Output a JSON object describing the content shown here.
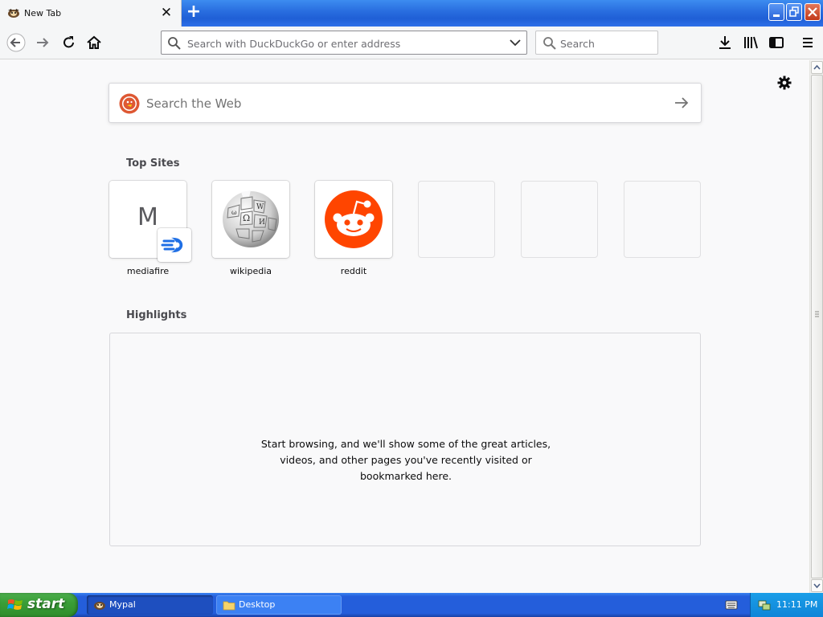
{
  "browser": {
    "tab": {
      "title": "New Tab",
      "close_icon": "close-icon",
      "favicon": "mypal-favicon"
    },
    "new_tab_icon": "plus-icon",
    "window_controls": [
      "minimize-icon",
      "restore-icon",
      "close-icon"
    ],
    "nav_icons": [
      "back-arrow-icon",
      "forward-arrow-icon",
      "reload-icon",
      "home-icon"
    ],
    "urlbar": {
      "placeholder": "Search with DuckDuckGo or enter address",
      "value": ""
    },
    "searchbar": {
      "placeholder": "Search",
      "value": ""
    },
    "toolbar_icons": [
      "download-icon",
      "library-icon",
      "sidebar-icon",
      "menu-icon"
    ]
  },
  "newtab": {
    "websearch": {
      "placeholder": "Search the Web"
    },
    "topsites_title": "Top Sites",
    "sites": [
      {
        "label": "mediafire",
        "letter": "M"
      },
      {
        "label": "wikipedia"
      },
      {
        "label": "reddit"
      }
    ],
    "empty_slots": 3,
    "highlights_title": "Highlights",
    "highlights_message_lines": [
      "Start browsing, and we'll show some of the great articles,",
      "videos, and other pages you've recently visited or",
      "bookmarked here."
    ]
  },
  "taskbar": {
    "start_label": "start",
    "tasks": [
      {
        "label": "Mypal",
        "active": true
      },
      {
        "label": "Desktop",
        "active": false
      }
    ],
    "clock": "11:11 PM"
  },
  "colors": {
    "accent_blue": "#245edb",
    "reddit": "#ff4500",
    "duckduckgo": "#de5833",
    "mediafire": "#1f6fe5",
    "start_green": "#3a9e37"
  }
}
